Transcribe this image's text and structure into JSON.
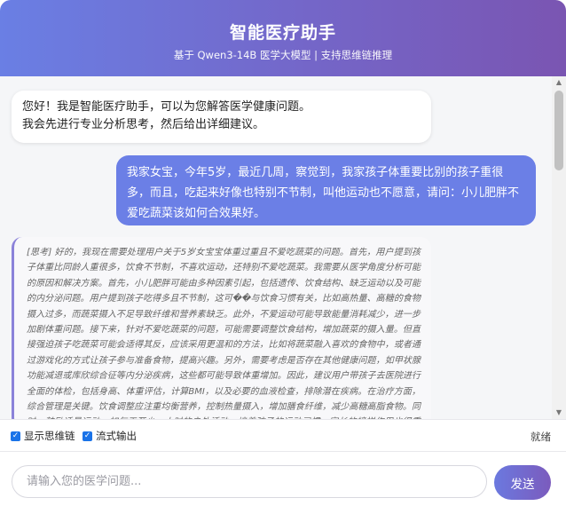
{
  "header": {
    "title": "智能医疗助手",
    "subtitle": "基于 Qwen3-14B 医学大模型 | 支持思维链推理"
  },
  "messages": {
    "ai_greeting_line1": "您好！我是智能医疗助手，可以为您解答医学健康问题。",
    "ai_greeting_line2": "我会先进行专业分析思考，然后给出详细建议。",
    "user_question": "我家女宝，今年5岁，最近几周，察觉到，我家孩子体重要比别的孩子重很多，而且，吃起来好像也特别不节制，叫他运动也不愿意，请问：小儿肥胖不爱吃蔬菜该如何合效果好。",
    "thinking": "[思考] 好的，我现在需要处理用户关于5岁女宝宝体重过重且不爱吃蔬菜的问题。首先，用户提到孩子体重比同龄人重很多，饮食不节制，不喜欢运动，还特别不爱吃蔬菜。我需要从医学角度分析可能的原因和解决方案。首先，小儿肥胖可能由多种因素引起，包括遗传、饮食结构、缺乏运动以及可能的内分泌问题。用户提到孩子吃得多且不节制，这可��与饮食习惯有关，比如高热量、高糖的食物摄入过多，而蔬菜摄入不足导致纤维和营养素缺乏。此外，不爱运动可能导致能量消耗减少，进一步加剧体重问题。接下来，针对不爱吃蔬菜的问题，可能需要调整饮食结构，增加蔬菜的摄入量。但直接强迫孩子吃蔬菜可能会适得其反，应该采用更温和的方法，比如将蔬菜融入喜欢的食物中，或者通过游戏化的方式让孩子参与准备食物，提高兴趣。另外，需要考虑是否存在其他健康问题，如甲状腺功能减退或库欣综合征等内分泌疾病，这些都可能导致体重增加。因此，建议用户带孩子去医院进行全面的体检，包括身高、体重评估，计算BMI，以及必要的血液检查，排除潜在疾病。在治疗方面，综合管理是关键。饮食调整应注重均衡营养，控制热量摄入，增加膳食纤维，减少高糖高脂食物。同时，鼓励适量运动，如每天至少一小时的户外活动，培养孩子的运动习惯。家长的榜样作用也很重要。"
  },
  "options": {
    "show_thinking_label": "显示思维链",
    "stream_output_label": "流式输出",
    "status_text": "就绪"
  },
  "input": {
    "placeholder": "请输入您的医学问题...",
    "send_label": "发送"
  },
  "colors": {
    "header_gradient_start": "#6a7fe4",
    "header_gradient_end": "#7a55b2",
    "user_bubble": "#6b7fe6",
    "thinking_border": "#8b82d9",
    "checkbox": "#1a73e8"
  }
}
